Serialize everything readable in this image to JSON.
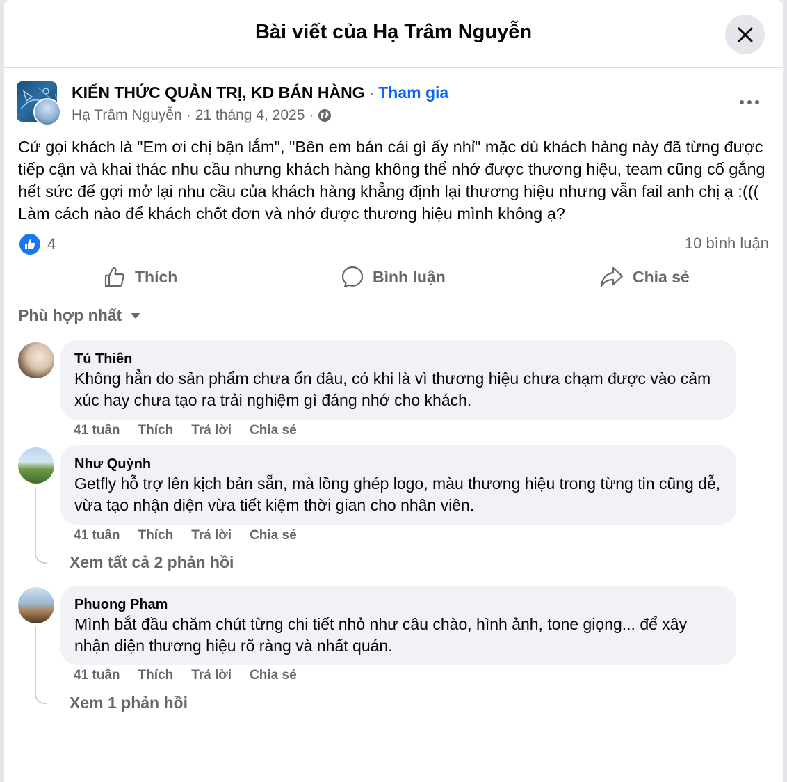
{
  "modal": {
    "title": "Bài viết của Hạ Trâm Nguyễn"
  },
  "post": {
    "group_name": "KIẾN THỨC QUẢN TRỊ, KD BÁN HÀNG",
    "separator": "·",
    "join_label": "Tham gia",
    "author": "Hạ Trâm Nguyễn",
    "date": "21 tháng 4, 2025",
    "privacy_icon": "globe-icon",
    "text": "Cứ gọi khách là \"Em ơi chị bận lắm\", \"Bên em bán cái gì ấy nhỉ\" mặc dù khách hàng này đã từng được tiếp cận và khai thác nhu cầu nhưng khách hàng không thể nhớ được thương hiệu, team cũng cố gắng hết sức để gợi mở lại nhu cầu của khách hàng khẳng định lại thương hiệu nhưng vẫn fail anh chị ạ :((( Làm cách nào để khách chốt đơn và nhớ được thương hiệu mình không ạ?",
    "reaction_count": "4",
    "comment_count": "10 bình luận"
  },
  "actions": {
    "like": "Thích",
    "comment": "Bình luận",
    "share": "Chia sẻ"
  },
  "sort_label": "Phù hợp nhất",
  "comments": [
    {
      "author": "Tú Thiên",
      "text": "Không hẳn do sản phẩm chưa ổn đâu, có khi là vì thương hiệu chưa chạm được vào cảm xúc hay chưa tạo ra trải nghiệm gì đáng nhớ cho khách.",
      "time": "41 tuần",
      "like": "Thích",
      "reply": "Trả lời",
      "share": "Chia sẻ"
    },
    {
      "author": "Như Quỳnh",
      "text": "Getfly hỗ trợ lên kịch bản sẵn, mà lồng ghép logo, màu thương hiệu trong từng tin cũng dễ, vừa tạo nhận diện vừa tiết kiệm thời gian cho nhân viên.",
      "time": "41 tuần",
      "like": "Thích",
      "reply": "Trả lời",
      "share": "Chia sẻ",
      "replies_label": "Xem tất cả 2 phản hồi"
    },
    {
      "author": "Phuong Pham",
      "text": "Mình bắt đầu chăm chút từng chi tiết nhỏ như câu chào, hình ảnh, tone giọng... để xây nhận diện thương hiệu rõ ràng và nhất quán.",
      "time": "41 tuần",
      "like": "Thích",
      "reply": "Trả lời",
      "share": "Chia sẻ",
      "replies_label": "Xem 1 phản hồi"
    }
  ],
  "colors": {
    "accent": "#0866ff",
    "like_badge": "#1877f2",
    "secondary_text": "#65676b",
    "bubble_bg": "#f0f2f5"
  }
}
